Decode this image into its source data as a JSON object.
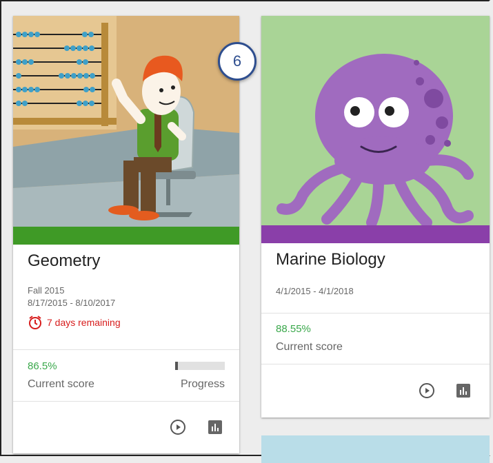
{
  "courses": [
    {
      "title": "Geometry",
      "term": "Fall 2015",
      "dates": "8/17/2015 - 8/10/2017",
      "remaining": "7 days remaining",
      "score": "86.5%",
      "score_label": "Current score",
      "progress_label": "Progress",
      "progress_fraction": 0.06,
      "image": "abacus-teacher-illustration",
      "band_color": "#3f9a26"
    },
    {
      "title": "Marine Biology",
      "dates": "4/1/2015 - 4/1/2018",
      "score": "88.55%",
      "score_label": "Current score",
      "image": "purple-octopus-illustration",
      "band_color": "#8a3fa9"
    }
  ],
  "badge": {
    "count": "6"
  },
  "colors": {
    "score_green": "#3aa84b",
    "warning_red": "#d71c1c",
    "badge_blue": "#2e4e8f"
  }
}
